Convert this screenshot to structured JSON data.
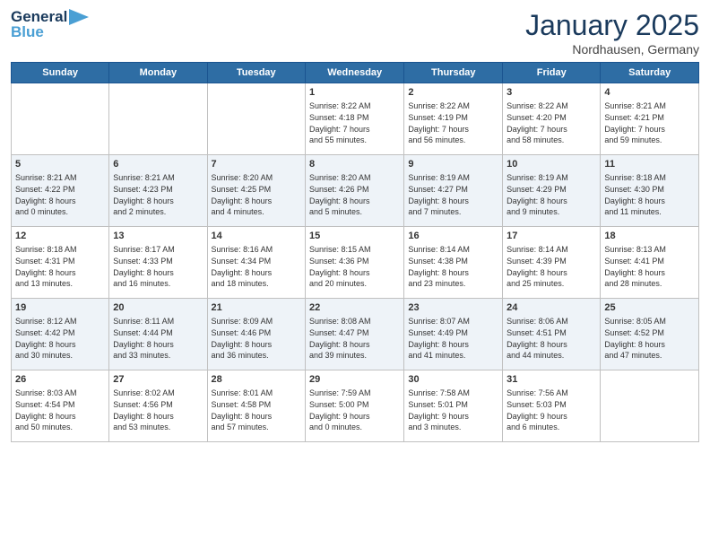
{
  "logo": {
    "line1": "General",
    "line2": "Blue"
  },
  "title": "January 2025",
  "subtitle": "Nordhausen, Germany",
  "days_header": [
    "Sunday",
    "Monday",
    "Tuesday",
    "Wednesday",
    "Thursday",
    "Friday",
    "Saturday"
  ],
  "weeks": [
    [
      {
        "day": "",
        "info": ""
      },
      {
        "day": "",
        "info": ""
      },
      {
        "day": "",
        "info": ""
      },
      {
        "day": "1",
        "info": "Sunrise: 8:22 AM\nSunset: 4:18 PM\nDaylight: 7 hours\nand 55 minutes."
      },
      {
        "day": "2",
        "info": "Sunrise: 8:22 AM\nSunset: 4:19 PM\nDaylight: 7 hours\nand 56 minutes."
      },
      {
        "day": "3",
        "info": "Sunrise: 8:22 AM\nSunset: 4:20 PM\nDaylight: 7 hours\nand 58 minutes."
      },
      {
        "day": "4",
        "info": "Sunrise: 8:21 AM\nSunset: 4:21 PM\nDaylight: 7 hours\nand 59 minutes."
      }
    ],
    [
      {
        "day": "5",
        "info": "Sunrise: 8:21 AM\nSunset: 4:22 PM\nDaylight: 8 hours\nand 0 minutes."
      },
      {
        "day": "6",
        "info": "Sunrise: 8:21 AM\nSunset: 4:23 PM\nDaylight: 8 hours\nand 2 minutes."
      },
      {
        "day": "7",
        "info": "Sunrise: 8:20 AM\nSunset: 4:25 PM\nDaylight: 8 hours\nand 4 minutes."
      },
      {
        "day": "8",
        "info": "Sunrise: 8:20 AM\nSunset: 4:26 PM\nDaylight: 8 hours\nand 5 minutes."
      },
      {
        "day": "9",
        "info": "Sunrise: 8:19 AM\nSunset: 4:27 PM\nDaylight: 8 hours\nand 7 minutes."
      },
      {
        "day": "10",
        "info": "Sunrise: 8:19 AM\nSunset: 4:29 PM\nDaylight: 8 hours\nand 9 minutes."
      },
      {
        "day": "11",
        "info": "Sunrise: 8:18 AM\nSunset: 4:30 PM\nDaylight: 8 hours\nand 11 minutes."
      }
    ],
    [
      {
        "day": "12",
        "info": "Sunrise: 8:18 AM\nSunset: 4:31 PM\nDaylight: 8 hours\nand 13 minutes."
      },
      {
        "day": "13",
        "info": "Sunrise: 8:17 AM\nSunset: 4:33 PM\nDaylight: 8 hours\nand 16 minutes."
      },
      {
        "day": "14",
        "info": "Sunrise: 8:16 AM\nSunset: 4:34 PM\nDaylight: 8 hours\nand 18 minutes."
      },
      {
        "day": "15",
        "info": "Sunrise: 8:15 AM\nSunset: 4:36 PM\nDaylight: 8 hours\nand 20 minutes."
      },
      {
        "day": "16",
        "info": "Sunrise: 8:14 AM\nSunset: 4:38 PM\nDaylight: 8 hours\nand 23 minutes."
      },
      {
        "day": "17",
        "info": "Sunrise: 8:14 AM\nSunset: 4:39 PM\nDaylight: 8 hours\nand 25 minutes."
      },
      {
        "day": "18",
        "info": "Sunrise: 8:13 AM\nSunset: 4:41 PM\nDaylight: 8 hours\nand 28 minutes."
      }
    ],
    [
      {
        "day": "19",
        "info": "Sunrise: 8:12 AM\nSunset: 4:42 PM\nDaylight: 8 hours\nand 30 minutes."
      },
      {
        "day": "20",
        "info": "Sunrise: 8:11 AM\nSunset: 4:44 PM\nDaylight: 8 hours\nand 33 minutes."
      },
      {
        "day": "21",
        "info": "Sunrise: 8:09 AM\nSunset: 4:46 PM\nDaylight: 8 hours\nand 36 minutes."
      },
      {
        "day": "22",
        "info": "Sunrise: 8:08 AM\nSunset: 4:47 PM\nDaylight: 8 hours\nand 39 minutes."
      },
      {
        "day": "23",
        "info": "Sunrise: 8:07 AM\nSunset: 4:49 PM\nDaylight: 8 hours\nand 41 minutes."
      },
      {
        "day": "24",
        "info": "Sunrise: 8:06 AM\nSunset: 4:51 PM\nDaylight: 8 hours\nand 44 minutes."
      },
      {
        "day": "25",
        "info": "Sunrise: 8:05 AM\nSunset: 4:52 PM\nDaylight: 8 hours\nand 47 minutes."
      }
    ],
    [
      {
        "day": "26",
        "info": "Sunrise: 8:03 AM\nSunset: 4:54 PM\nDaylight: 8 hours\nand 50 minutes."
      },
      {
        "day": "27",
        "info": "Sunrise: 8:02 AM\nSunset: 4:56 PM\nDaylight: 8 hours\nand 53 minutes."
      },
      {
        "day": "28",
        "info": "Sunrise: 8:01 AM\nSunset: 4:58 PM\nDaylight: 8 hours\nand 57 minutes."
      },
      {
        "day": "29",
        "info": "Sunrise: 7:59 AM\nSunset: 5:00 PM\nDaylight: 9 hours\nand 0 minutes."
      },
      {
        "day": "30",
        "info": "Sunrise: 7:58 AM\nSunset: 5:01 PM\nDaylight: 9 hours\nand 3 minutes."
      },
      {
        "day": "31",
        "info": "Sunrise: 7:56 AM\nSunset: 5:03 PM\nDaylight: 9 hours\nand 6 minutes."
      },
      {
        "day": "",
        "info": ""
      }
    ]
  ]
}
